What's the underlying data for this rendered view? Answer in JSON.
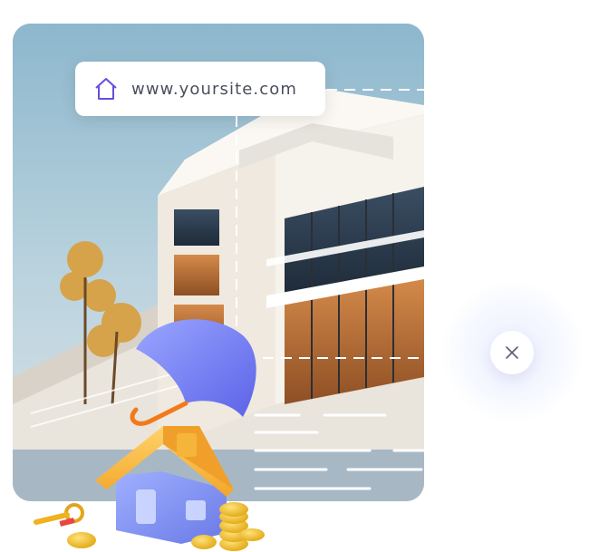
{
  "url_bar": {
    "url": "www.yoursite.com",
    "icon": "home-icon"
  },
  "close_button": {
    "icon": "close-icon"
  },
  "colors": {
    "accent": "#6a4ce0",
    "umbrella": "#7b86f2",
    "roof": "#f5b43a",
    "coins": "#f0c028"
  }
}
